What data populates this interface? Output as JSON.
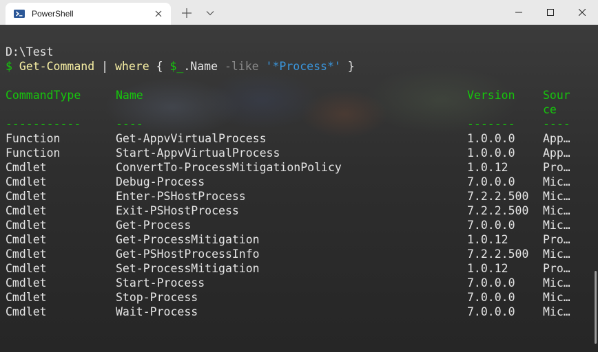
{
  "window": {
    "tab_title": "PowerShell",
    "tab_icon": "powershell-icon",
    "accent": "#16c60c"
  },
  "terminal": {
    "path_line": "D:\\Test",
    "prompt_symbol": "$",
    "command": {
      "cmd": "Get-Command",
      "pipe": "|",
      "where": "where",
      "brace_open": "{",
      "var": "$_",
      "prop": ".Name",
      "op": "-like",
      "pattern": "'*Process*'",
      "brace_close": "}"
    },
    "columns": {
      "type": "CommandType",
      "name": "Name",
      "version": "Version",
      "source_line1": "Sour",
      "source_line2": "ce"
    },
    "underlines": {
      "type": "-----------",
      "name": "----",
      "version": "-------",
      "source": "----"
    },
    "rows": [
      {
        "type": "Function",
        "name": "Get-AppvVirtualProcess",
        "version": "1.0.0.0",
        "source": "App…"
      },
      {
        "type": "Function",
        "name": "Start-AppvVirtualProcess",
        "version": "1.0.0.0",
        "source": "App…"
      },
      {
        "type": "Cmdlet",
        "name": "ConvertTo-ProcessMitigationPolicy",
        "version": "1.0.12",
        "source": "Pro…"
      },
      {
        "type": "Cmdlet",
        "name": "Debug-Process",
        "version": "7.0.0.0",
        "source": "Mic…"
      },
      {
        "type": "Cmdlet",
        "name": "Enter-PSHostProcess",
        "version": "7.2.2.500",
        "source": "Mic…"
      },
      {
        "type": "Cmdlet",
        "name": "Exit-PSHostProcess",
        "version": "7.2.2.500",
        "source": "Mic…"
      },
      {
        "type": "Cmdlet",
        "name": "Get-Process",
        "version": "7.0.0.0",
        "source": "Mic…"
      },
      {
        "type": "Cmdlet",
        "name": "Get-ProcessMitigation",
        "version": "1.0.12",
        "source": "Pro…"
      },
      {
        "type": "Cmdlet",
        "name": "Get-PSHostProcessInfo",
        "version": "7.2.2.500",
        "source": "Mic…"
      },
      {
        "type": "Cmdlet",
        "name": "Set-ProcessMitigation",
        "version": "1.0.12",
        "source": "Pro…"
      },
      {
        "type": "Cmdlet",
        "name": "Start-Process",
        "version": "7.0.0.0",
        "source": "Mic…"
      },
      {
        "type": "Cmdlet",
        "name": "Stop-Process",
        "version": "7.0.0.0",
        "source": "Mic…"
      },
      {
        "type": "Cmdlet",
        "name": "Wait-Process",
        "version": "7.0.0.0",
        "source": "Mic…"
      }
    ]
  }
}
